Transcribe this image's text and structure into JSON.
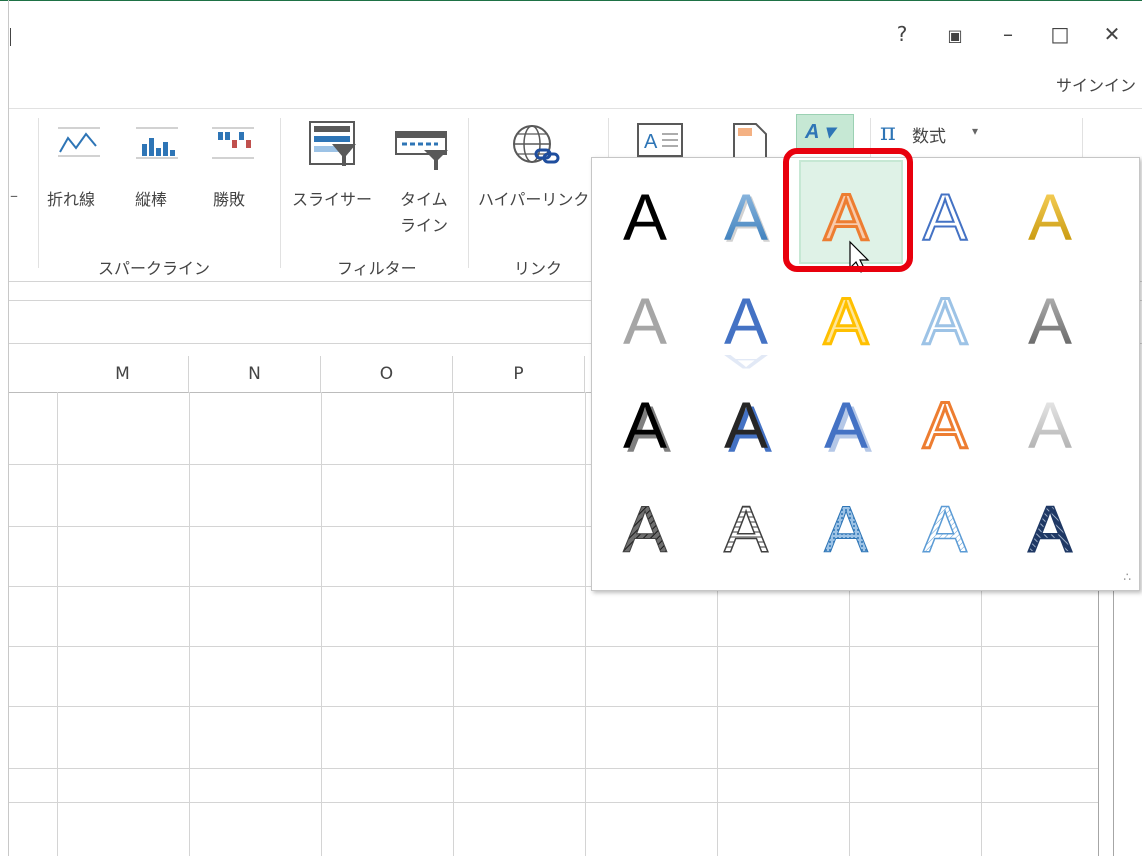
{
  "window": {
    "help": "?",
    "restore_ribbon": "▣",
    "minimize": "–",
    "maximize": "□",
    "close": "✕",
    "signin": "サインイン"
  },
  "ribbon": {
    "sparklines": {
      "line_label": "折れ線",
      "column_label": "縦棒",
      "winloss_label": "勝敗",
      "group_label": "スパークライン"
    },
    "filters": {
      "slicer_label": "スライサー",
      "timeline_label_1": "タイム",
      "timeline_label_2": "ライン",
      "group_label": "フィルター"
    },
    "links": {
      "hyperlink_label": "ハイパーリンク",
      "group_label": "リンク"
    },
    "text": {
      "wordart_button_glyph": "A ▾"
    },
    "symbols": {
      "equation_glyph": "π",
      "equation_label": "数式",
      "equation_arrow": "▾"
    },
    "left_dash": "–"
  },
  "sheet": {
    "columns": [
      "M",
      "N",
      "O",
      "P"
    ]
  },
  "wordart_gallery": {
    "glyph": "A",
    "rows": [
      [
        {
          "style": "fill-black"
        },
        {
          "style": "fill-blue-shadow"
        },
        {
          "style": "outline-orange-selected"
        },
        {
          "style": "outline-blue"
        },
        {
          "style": "fill-gold"
        }
      ],
      [
        {
          "style": "fill-gray"
        },
        {
          "style": "fill-blue-reflect"
        },
        {
          "style": "outline-gold"
        },
        {
          "style": "outline-lightblue"
        },
        {
          "style": "fill-gray-dark"
        }
      ],
      [
        {
          "style": "black-shadow"
        },
        {
          "style": "black-blue-shadow"
        },
        {
          "style": "blue-shadow"
        },
        {
          "style": "outline-orange"
        },
        {
          "style": "silver"
        }
      ],
      [
        {
          "style": "pattern-dark"
        },
        {
          "style": "pattern-gray"
        },
        {
          "style": "pattern-blue"
        },
        {
          "style": "pattern-lightblue"
        },
        {
          "style": "pattern-navy"
        }
      ]
    ],
    "resize_grip": "∴"
  },
  "colors": {
    "accent_green": "#1e7145",
    "highlight_red": "#e8000d",
    "selected_bg": "#dff2e7"
  }
}
